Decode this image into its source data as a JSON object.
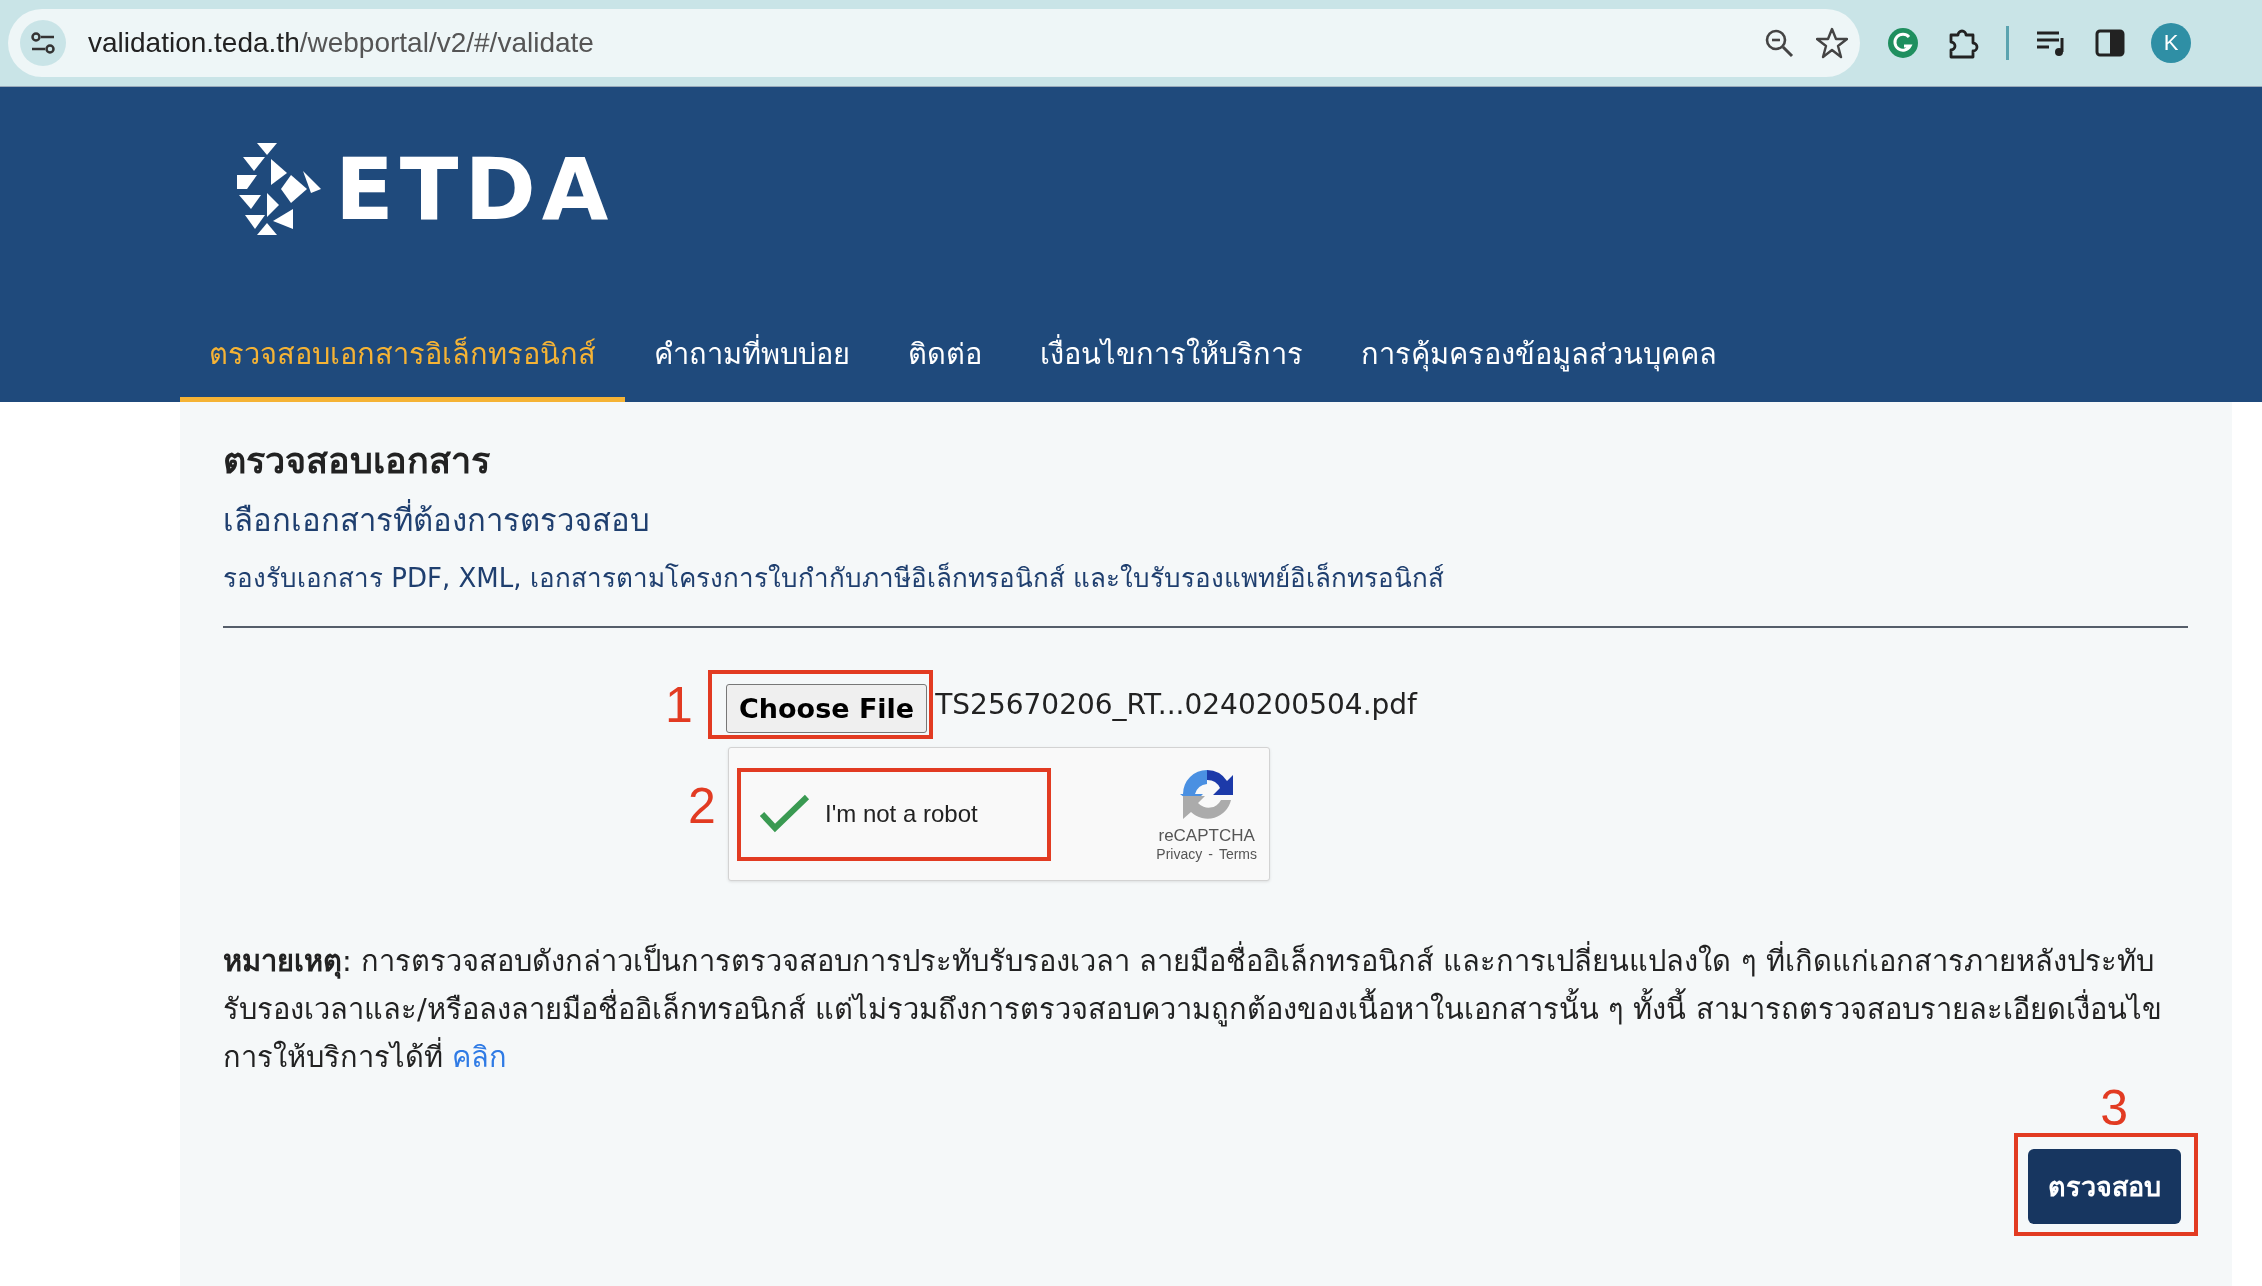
{
  "browser": {
    "url_host": "validation.teda.th",
    "url_path": "/webportal/v2/#/validate",
    "profile": "K"
  },
  "header": {
    "logo_text": "ETDA",
    "nav": [
      {
        "label": "ตรวจสอบเอกสารอิเล็กทรอนิกส์",
        "selected": true
      },
      {
        "label": "คำถามที่พบบ่อย",
        "selected": false
      },
      {
        "label": "ติดต่อ",
        "selected": false
      },
      {
        "label": "เงื่อนไขการให้บริการ",
        "selected": false
      },
      {
        "label": "การคุ้มครองข้อมูลส่วนบุคคล",
        "selected": false
      }
    ]
  },
  "page": {
    "title": "ตรวจสอบเอกสาร",
    "subtitle": "เลือกเอกสารที่ต้องการตรวจสอบ",
    "supported": "รองรับเอกสาร PDF, XML, เอกสารตามโครงการใบกำกับภาษีอิเล็กทรอนิกส์ และใบรับรองแพทย์อิเล็กทรอนิกส์"
  },
  "upload": {
    "marker": "1",
    "button": "Choose File",
    "file_name": "TS25670206_RT...0240200504.pdf"
  },
  "captcha": {
    "marker": "2",
    "checked": true,
    "label": "I'm not a robot",
    "brand": "reCAPTCHA",
    "privacy": "Privacy",
    "separator": "-",
    "terms": "Terms"
  },
  "note": {
    "text": "**หมายเหตุ**: การตรวจสอบดังกล่าวเป็นการตรวจสอบการประทับรับรองเวลา ลายมือชื่ออิเล็กทรอนิกส์ และการเปลี่ยนแปลงใด ๆ ที่เกิดแก่เอกสารภายหลังประทับรับรองเวลาและ/หรือลงลายมือชื่ออิเล็กทรอนิกส์ แต่ไม่รวมถึงการตรวจสอบความถูกต้องของเนื้อหาในเอกสารนั้น ๆ ทั้งนี้ สามารถตรวจสอบรายละเอียดเงื่อนไขการให้บริการได้ที่",
    "link": "คลิก"
  },
  "submit": {
    "marker": "3",
    "label": "ตรวจสอบ"
  }
}
